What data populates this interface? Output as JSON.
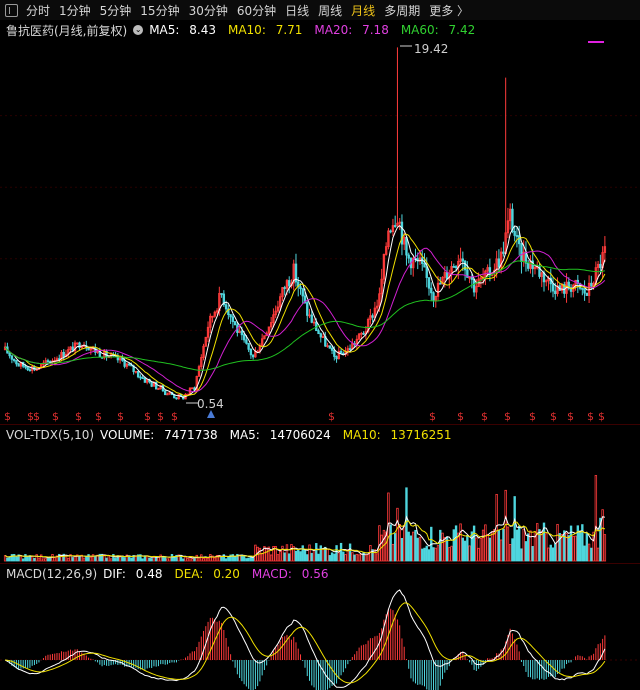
{
  "toolbar": {
    "periods": [
      {
        "label": "分时",
        "active": false
      },
      {
        "label": "1分钟",
        "active": false
      },
      {
        "label": "5分钟",
        "active": false
      },
      {
        "label": "15分钟",
        "active": false
      },
      {
        "label": "30分钟",
        "active": false
      },
      {
        "label": "60分钟",
        "active": false
      },
      {
        "label": "日线",
        "active": false
      },
      {
        "label": "周线",
        "active": false
      },
      {
        "label": "月线",
        "active": true
      },
      {
        "label": "多周期",
        "active": false
      },
      {
        "label": "更多",
        "active": false
      }
    ],
    "more_icon": "chevron-right-icon"
  },
  "colors": {
    "up": "#ff3b3b",
    "down": "#4fd6de",
    "ma5": "#ffffff",
    "ma10": "#f0e000",
    "ma20": "#d020d0",
    "ma60": "#20c020",
    "marker": "#e03030"
  },
  "main_panel": {
    "title": "鲁抗医药(月线,前复权)",
    "ma5": {
      "label": "MA5:",
      "value": "8.43"
    },
    "ma10": {
      "label": "MA10:",
      "value": "7.71"
    },
    "ma20": {
      "label": "MA20:",
      "value": "7.18"
    },
    "ma60": {
      "label": "MA60:",
      "value": "7.42"
    },
    "high_label": "19.42",
    "low_label": "0.54"
  },
  "volume_panel": {
    "title": "VOL-TDX(5,10)",
    "volume": {
      "label": "VOLUME:",
      "value": "7471738"
    },
    "ma5": {
      "label": "MA5:",
      "value": "14706024"
    },
    "ma10": {
      "label": "MA10:",
      "value": "13716251"
    }
  },
  "macd_panel": {
    "title": "MACD(12,26,9)",
    "dif": {
      "label": "DIF:",
      "value": "0.48"
    },
    "dea": {
      "label": "DEA:",
      "value": "0.20"
    },
    "macd": {
      "label": "MACD:",
      "value": "0.56"
    }
  },
  "chart_data": {
    "type": "candlestick",
    "series_high": 19.42,
    "series_low": 0.54,
    "last": {
      "ma5": 8.43,
      "ma10": 7.71,
      "ma20": 7.18,
      "ma60": 7.42,
      "volume": 7471738,
      "vol_ma5": 14706024,
      "vol_ma10": 13716251,
      "dif": 0.48,
      "dea": 0.2,
      "macd": 0.56
    },
    "price_keypoints": [
      [
        0,
        3.2
      ],
      [
        6,
        2.4
      ],
      [
        14,
        2.2
      ],
      [
        26,
        3.0
      ],
      [
        34,
        3.6
      ],
      [
        42,
        3.0
      ],
      [
        52,
        2.6
      ],
      [
        62,
        1.6
      ],
      [
        72,
        0.9
      ],
      [
        78,
        0.6
      ],
      [
        84,
        1.2
      ],
      [
        90,
        4.5
      ],
      [
        96,
        6.2
      ],
      [
        100,
        5.0
      ],
      [
        104,
        4.0
      ],
      [
        110,
        2.8
      ],
      [
        118,
        4.8
      ],
      [
        124,
        6.6
      ],
      [
        128,
        7.4
      ],
      [
        134,
        5.2
      ],
      [
        140,
        3.9
      ],
      [
        146,
        2.8
      ],
      [
        152,
        3.2
      ],
      [
        160,
        4.3
      ],
      [
        166,
        6.0
      ],
      [
        170,
        9.8
      ],
      [
        174,
        10.6
      ],
      [
        178,
        8.2
      ],
      [
        184,
        7.8
      ],
      [
        190,
        6.2
      ],
      [
        196,
        7.3
      ],
      [
        202,
        8.4
      ],
      [
        208,
        6.6
      ],
      [
        214,
        7.2
      ],
      [
        220,
        8.2
      ],
      [
        224,
        10.4
      ],
      [
        228,
        8.4
      ],
      [
        234,
        7.8
      ],
      [
        240,
        7.0
      ],
      [
        246,
        6.4
      ],
      [
        252,
        6.7
      ],
      [
        258,
        6.2
      ],
      [
        263,
        7.6
      ],
      [
        266,
        8.43
      ]
    ],
    "spike_bars": [
      [
        174,
        19.42
      ],
      [
        222,
        17.8
      ]
    ],
    "up_markers_count": 20,
    "down_markers_count": 1
  }
}
